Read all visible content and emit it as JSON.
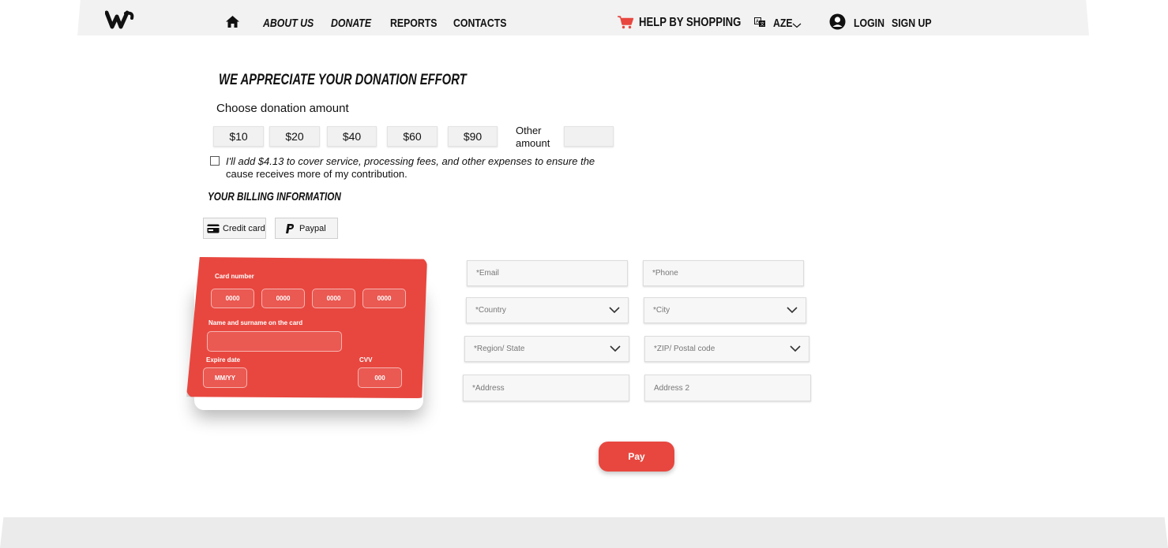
{
  "nav": {
    "about": "ABOUT US",
    "donate": "DONATE",
    "reports": "REPORTS",
    "contacts": "CONTACTS",
    "help_shopping": "HELP BY SHOPPING",
    "language": "AZE",
    "login": "LOGIN",
    "signup": "SIGN UP"
  },
  "donation": {
    "title": "WE APPRECIATE YOUR DONATION EFFORT",
    "choose_label": "Choose donation amount",
    "amounts": [
      "$10",
      "$20",
      "$40",
      "$60",
      "$90"
    ],
    "other_line1": "Other",
    "other_line2": "amount",
    "fee_line1": "I'll add $4.13 to cover service, processing fees, and other expenses to ensure the",
    "fee_line2": "cause receives more of my contribution."
  },
  "billing": {
    "title": "YOUR BILLING INFORMATION",
    "credit_card": "Credit card",
    "paypal": "Paypal"
  },
  "card": {
    "number_label": "Card number",
    "number_placeholders": [
      "0000",
      "0000",
      "0000",
      "0000"
    ],
    "name_label": "Name and surname on the card",
    "expire_label": "Expire date",
    "expire_placeholder": "MM/YY",
    "cvv_label": "CVV",
    "cvv_placeholder": "000"
  },
  "form": {
    "email": "*Email",
    "phone": "*Phone",
    "country": "*Country",
    "city": "*City",
    "region": "*Region/ State",
    "zip": "*ZIP/ Postal code",
    "address": "*Address",
    "address2": "Address 2"
  },
  "pay_label": "Pay",
  "colors": {
    "accent": "#e8473f",
    "header_bg": "#f2f2f2"
  }
}
